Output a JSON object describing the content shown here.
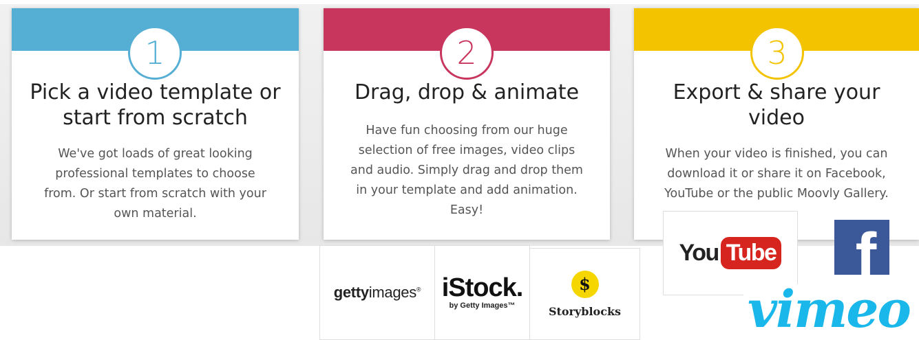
{
  "steps": [
    {
      "number": "1",
      "color": "#55aed4",
      "title_lines": [
        "Pick a video template or",
        "start from scratch"
      ],
      "body_lines": [
        "We've got loads of great looking",
        "professional templates to choose",
        "from. Or start from scratch with your",
        "own material."
      ]
    },
    {
      "number": "2",
      "color": "#c8365e",
      "title_lines": [
        "Drag, drop & animate"
      ],
      "body_lines": [
        "Have fun choosing from our huge",
        "selection of free images, video clips",
        "and audio. Simply drag and drop them",
        "in your template and add animation.",
        "Easy!"
      ]
    },
    {
      "number": "3",
      "color": "#f3c300",
      "title_lines": [
        "Export & share your",
        "video"
      ],
      "body_lines": [
        "When your video is finished, you can",
        "download it or share it on Facebook,",
        "YouTube or the public Moovly Gallery."
      ]
    }
  ],
  "logos": {
    "getty": {
      "bold": "getty",
      "regular": "images",
      "mark": "®"
    },
    "istock": {
      "main": "iStock.",
      "sub": "by Getty Images™"
    },
    "storyblocks": {
      "symbol": "$",
      "name": "Storyblocks",
      "color": "#f5d600"
    },
    "youtube": {
      "you": "You",
      "tube": "Tube",
      "color": "#d6251e"
    },
    "facebook": {
      "letter": "f",
      "color": "#3b5998"
    },
    "vimeo": {
      "text": "vimeo",
      "color": "#1ab7ea"
    }
  }
}
